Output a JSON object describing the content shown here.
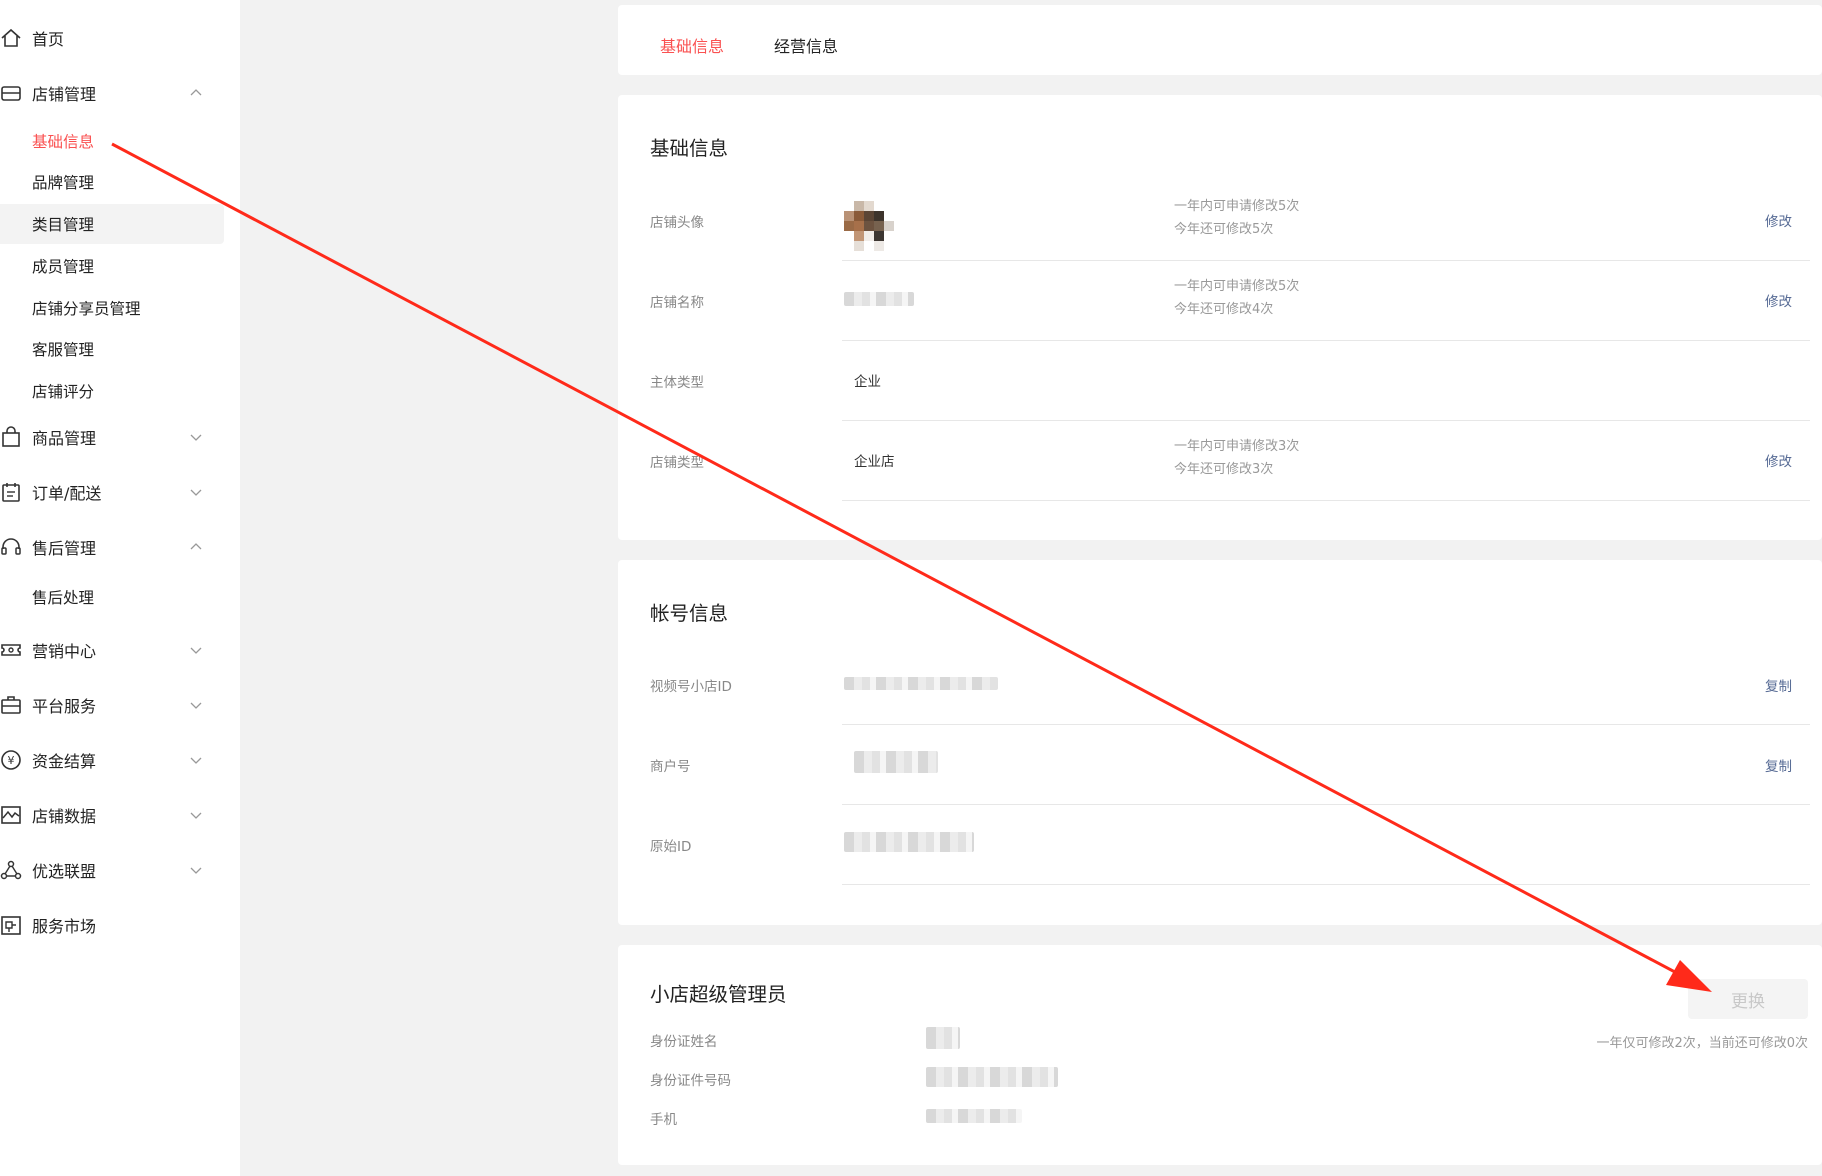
{
  "sidebar": {
    "home": "首页",
    "store_mgmt": "店铺管理",
    "store_sub": [
      "基础信息",
      "品牌管理",
      "类目管理",
      "成员管理",
      "店铺分享员管理",
      "客服管理",
      "店铺评分"
    ],
    "goods": "商品管理",
    "orders": "订单/配送",
    "aftersale": "售后管理",
    "aftersale_sub": "售后处理",
    "marketing": "营销中心",
    "platform": "平台服务",
    "funds": "资金结算",
    "data": "店铺数据",
    "alliance": "优选联盟",
    "market": "服务市场"
  },
  "tabs": [
    "基础信息",
    "经营信息"
  ],
  "basic": {
    "title": "基础信息",
    "rows": [
      {
        "label": "店铺头像",
        "hint1": "一年内可申请修改5次",
        "hint2": "今年还可修改5次",
        "action": "修改"
      },
      {
        "label": "店铺名称",
        "hint1": "一年内可申请修改5次",
        "hint2": "今年还可修改4次",
        "action": "修改"
      },
      {
        "label": "主体类型",
        "value": "企业"
      },
      {
        "label": "店铺类型",
        "value": "企业店",
        "hint1": "一年内可申请修改3次",
        "hint2": "今年还可修改3次",
        "action": "修改"
      }
    ]
  },
  "account": {
    "title": "帐号信息",
    "rows": [
      {
        "label": "视频号小店ID",
        "action": "复制"
      },
      {
        "label": "商户号",
        "action": "复制"
      },
      {
        "label": "原始ID"
      }
    ]
  },
  "admin": {
    "title": "小店超级管理员",
    "button": "更换",
    "hint": "一年仅可修改2次，当前还可修改0次",
    "labels": [
      "身份证姓名",
      "身份证件号码",
      "手机"
    ]
  },
  "colors": {
    "accent": "#fa5151",
    "link": "#576b95",
    "arrow": "#ff2a1a"
  }
}
